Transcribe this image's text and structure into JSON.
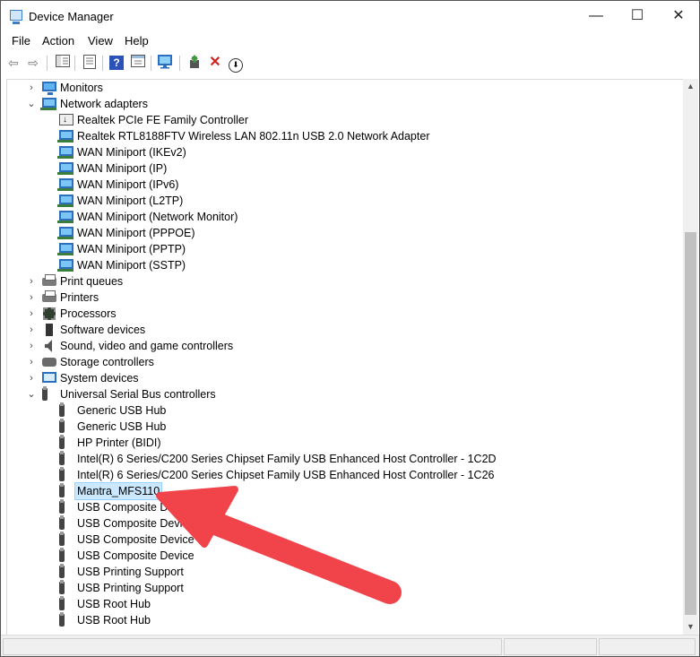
{
  "window": {
    "title": "Device Manager"
  },
  "title_buttons": {
    "minimize": "—",
    "maximize": "☐",
    "close": "✕"
  },
  "menu": [
    "File",
    "Action",
    "View",
    "Help"
  ],
  "toolbar": {
    "back": "⇦",
    "forward": "⇨",
    "help": "?",
    "remove": "✕",
    "update": "⬇"
  },
  "tree": [
    {
      "label": "Monitors",
      "expander": "›",
      "icon": "monitor-icon"
    },
    {
      "label": "Network adapters",
      "expander": "⌄",
      "icon": "network-adapter-icon"
    },
    {
      "label": "Realtek PCIe FE Family Controller",
      "icon": "network-card-icon"
    },
    {
      "label": "Realtek RTL8188FTV Wireless LAN 802.11n USB 2.0 Network Adapter",
      "icon": "network-adapter-icon"
    },
    {
      "label": "WAN Miniport (IKEv2)",
      "icon": "network-adapter-icon"
    },
    {
      "label": "WAN Miniport (IP)",
      "icon": "network-adapter-icon"
    },
    {
      "label": "WAN Miniport (IPv6)",
      "icon": "network-adapter-icon"
    },
    {
      "label": "WAN Miniport (L2TP)",
      "icon": "network-adapter-icon"
    },
    {
      "label": "WAN Miniport (Network Monitor)",
      "icon": "network-adapter-icon"
    },
    {
      "label": "WAN Miniport (PPPOE)",
      "icon": "network-adapter-icon"
    },
    {
      "label": "WAN Miniport (PPTP)",
      "icon": "network-adapter-icon"
    },
    {
      "label": "WAN Miniport (SSTP)",
      "icon": "network-adapter-icon"
    },
    {
      "label": "Print queues",
      "expander": "›",
      "icon": "printer-icon"
    },
    {
      "label": "Printers",
      "expander": "›",
      "icon": "printer-icon"
    },
    {
      "label": "Processors",
      "expander": "›",
      "icon": "processor-icon"
    },
    {
      "label": "Software devices",
      "expander": "›",
      "icon": "software-device-icon"
    },
    {
      "label": "Sound, video and game controllers",
      "expander": "›",
      "icon": "speaker-icon"
    },
    {
      "label": "Storage controllers",
      "expander": "›",
      "icon": "storage-icon"
    },
    {
      "label": "System devices",
      "expander": "›",
      "icon": "system-device-icon"
    },
    {
      "label": "Universal Serial Bus controllers",
      "expander": "⌄",
      "icon": "usb-icon"
    },
    {
      "label": "Generic USB Hub",
      "icon": "usb-icon"
    },
    {
      "label": "Generic USB Hub",
      "icon": "usb-icon"
    },
    {
      "label": "HP Printer (BIDI)",
      "icon": "usb-icon"
    },
    {
      "label": "Intel(R) 6 Series/C200 Series Chipset Family USB Enhanced Host Controller - 1C2D",
      "icon": "usb-icon"
    },
    {
      "label": "Intel(R) 6 Series/C200 Series Chipset Family USB Enhanced Host Controller - 1C26",
      "icon": "usb-icon"
    },
    {
      "label": "Mantra_MFS110",
      "icon": "usb-icon",
      "selected": true
    },
    {
      "label": "USB Composite Device",
      "icon": "usb-icon"
    },
    {
      "label": "USB Composite Device",
      "icon": "usb-icon"
    },
    {
      "label": "USB Composite Device",
      "icon": "usb-icon"
    },
    {
      "label": "USB Composite Device",
      "icon": "usb-icon"
    },
    {
      "label": "USB Printing Support",
      "icon": "usb-icon"
    },
    {
      "label": "USB Printing Support",
      "icon": "usb-icon"
    },
    {
      "label": "USB Root Hub",
      "icon": "usb-icon"
    },
    {
      "label": "USB Root Hub",
      "icon": "usb-icon"
    }
  ],
  "scrollbar": {
    "up": "▲",
    "down": "▼"
  },
  "colors": {
    "selection": "#cce8ff",
    "arrow": "#f0434a"
  }
}
